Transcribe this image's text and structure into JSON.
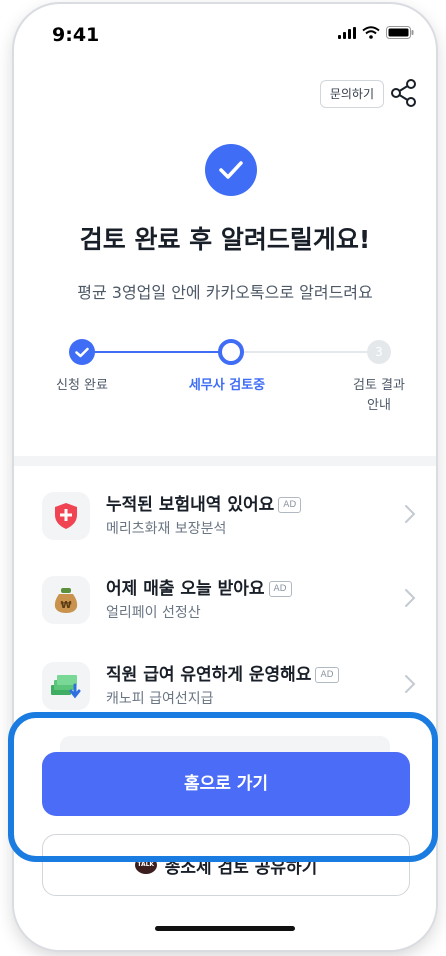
{
  "status": {
    "time": "9:41"
  },
  "header": {
    "inquiry_label": "문의하기"
  },
  "hero": {
    "title": "검토 완료 후 알려드릴게요!",
    "subtitle": "평균 3영업일 안에 카카오톡으로 알려드려요"
  },
  "steps": {
    "items": [
      {
        "label": "신청 완료",
        "state": "done"
      },
      {
        "label": "세무사 검토중",
        "state": "current"
      },
      {
        "label": "검토 결과\n안내",
        "number": "3",
        "state": "todo"
      }
    ]
  },
  "ads": [
    {
      "title": "누적된 보험내역 있어요",
      "badge": "AD",
      "subtitle": "메리츠화재 보장분석",
      "icon": "shield-plus-icon"
    },
    {
      "title": "어제 매출 오늘 받아요",
      "badge": "AD",
      "subtitle": "얼리페이 선정산",
      "icon": "money-bag-icon"
    },
    {
      "title": "직원 급여 유연하게 운영해요",
      "badge": "AD",
      "subtitle": "캐노피 급여선지급",
      "icon": "cash-stack-icon"
    }
  ],
  "actions": {
    "home_label": "홈으로 가기",
    "share_label": "종소세 검토 공유하기",
    "kakao_badge": "TALK"
  },
  "colors": {
    "accent": "#3f6df5",
    "highlight": "#1a7ce0"
  }
}
